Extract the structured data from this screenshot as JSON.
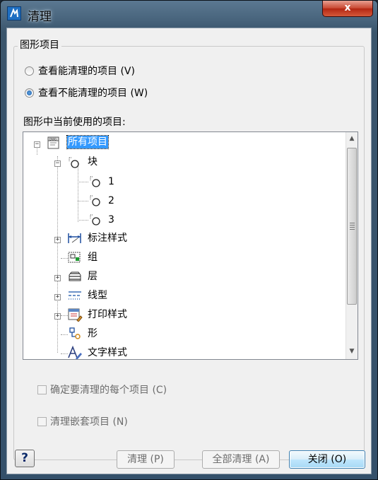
{
  "window": {
    "title": "清理",
    "close_glyph": "x"
  },
  "group": {
    "label": "图形项目"
  },
  "radio_options": [
    {
      "label": "查看能清理的项目 (V)",
      "checked": false
    },
    {
      "label": "查看不能清理的项目 (W)",
      "checked": true
    }
  ],
  "tree_label": "图形中当前使用的项目:",
  "tree": {
    "root": "所有项目",
    "items": {
      "block": "块",
      "block_1": "1",
      "block_2": "2",
      "block_3": "3",
      "dimstyle": "标注样式",
      "group": "组",
      "layer": "层",
      "linetype": "线型",
      "plotstyle": "打印样式",
      "shape": "形",
      "textstyle": "文字样式"
    }
  },
  "checkboxes": [
    {
      "label": "确定要清理的每个项目 (C)",
      "checked": false,
      "enabled": false
    },
    {
      "label": "清理嵌套项目 (N)",
      "checked": false,
      "enabled": false
    }
  ],
  "buttons": {
    "help": "?",
    "purge": "清理 (P)",
    "purge_all": "全部清理 (A)",
    "close": "关闭 (O)"
  }
}
